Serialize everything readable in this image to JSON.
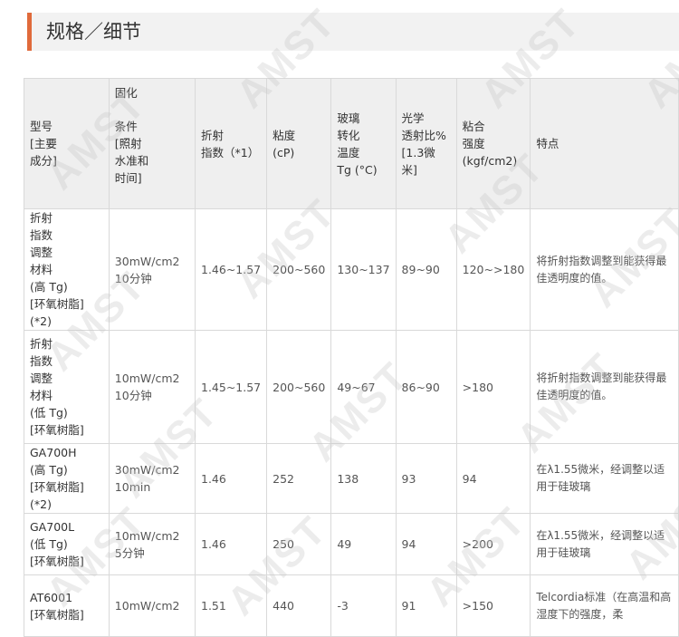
{
  "page": {
    "title": "规格／细节"
  },
  "table": {
    "headers": {
      "model": "型号\n[主要\n成分]",
      "cure_top": "固化",
      "cure_bottom": "条件\n[照射\n水准和\n时间]",
      "index": "折射\n指数（*1）",
      "viscosity": "粘度\n(cP)",
      "tg": "玻璃\n转化\n温度\nTg (°C)",
      "transmittance": "光学\n透射比%\n[1.3微米]",
      "adhesion": "粘合\n强度\n(kgf/cm2)",
      "feature": "特点"
    },
    "rows": [
      {
        "model": "折射\n指数\n调整\n材料\n(高 Tg)\n[环氧树脂](*2)",
        "cure_line1": "30mW/cm2",
        "cure_line2": "10分钟",
        "index": "1.46~1.57",
        "viscosity": "200~560",
        "tg": "130~137",
        "transmittance": "89~90",
        "adhesion": "120~>180",
        "feature": "将折射指数调整到能获得最佳透明度的值。"
      },
      {
        "model": "折射\n指数\n调整\n材料\n(低 Tg)\n[环氧树脂]",
        "cure_line1": "10mW/cm2",
        "cure_line2": "10分钟",
        "index": "1.45~1.57",
        "viscosity": "200~560",
        "tg": "49~67",
        "transmittance": "86~90",
        "adhesion": ">180",
        "feature": "将折射指数调整到能获得最佳透明度的值。"
      },
      {
        "model": "GA700H\n(高 Tg)\n[环氧树脂](*2)",
        "cure_line1": "30mW/cm2",
        "cure_line2": "10min",
        "index": "1.46",
        "viscosity": "252",
        "tg": "138",
        "transmittance": "93",
        "adhesion": "94",
        "feature": "在λ1.55微米，经调整以适用于硅玻璃"
      },
      {
        "model": "GA700L\n(低 Tg)\n[环氧树脂]",
        "cure_line1": "10mW/cm2",
        "cure_line2": "5分钟",
        "index": "1.46",
        "viscosity": "250",
        "tg": "49",
        "transmittance": "94",
        "adhesion": ">200",
        "feature": "在λ1.55微米，经调整以适用于硅玻璃"
      },
      {
        "model": "AT6001\n[环氧树脂]",
        "cure_line1": "10mW/cm2",
        "cure_line2": "",
        "index": "1.51",
        "viscosity": "440",
        "tg": "-3",
        "transmittance": "91",
        "adhesion": ">150",
        "feature": "Telcordia标准（在高温和高湿度下的强度，柔"
      }
    ]
  },
  "watermark_text": "AMST",
  "colors": {
    "accent": "#e06a3b",
    "header_bg": "#efefef",
    "border": "#d9d9d9"
  }
}
